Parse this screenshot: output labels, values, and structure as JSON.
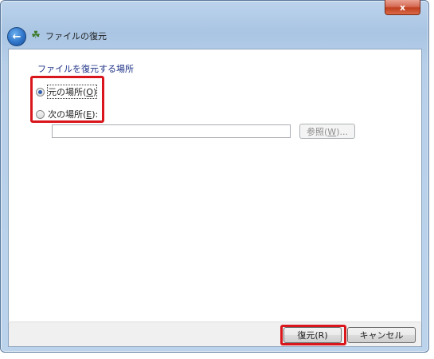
{
  "window": {
    "title": "ファイルの復元",
    "close_label": "x"
  },
  "content": {
    "heading": "ファイルを復元する場所",
    "option_original": {
      "label": "元の場所",
      "mnemonic": "O",
      "selected": true
    },
    "option_other": {
      "label": "次の場所",
      "mnemonic": "E",
      "suffix": ":",
      "selected": false
    },
    "path_value": "",
    "browse_button": {
      "label": "参照",
      "mnemonic": "W",
      "suffix": "..."
    }
  },
  "footer": {
    "restore_button": {
      "label": "復元",
      "mnemonic": "R"
    },
    "cancel_button": {
      "label": "キャンセル"
    }
  },
  "colors": {
    "highlight_box": "#d9161c",
    "heading_text": "#1e3287"
  }
}
